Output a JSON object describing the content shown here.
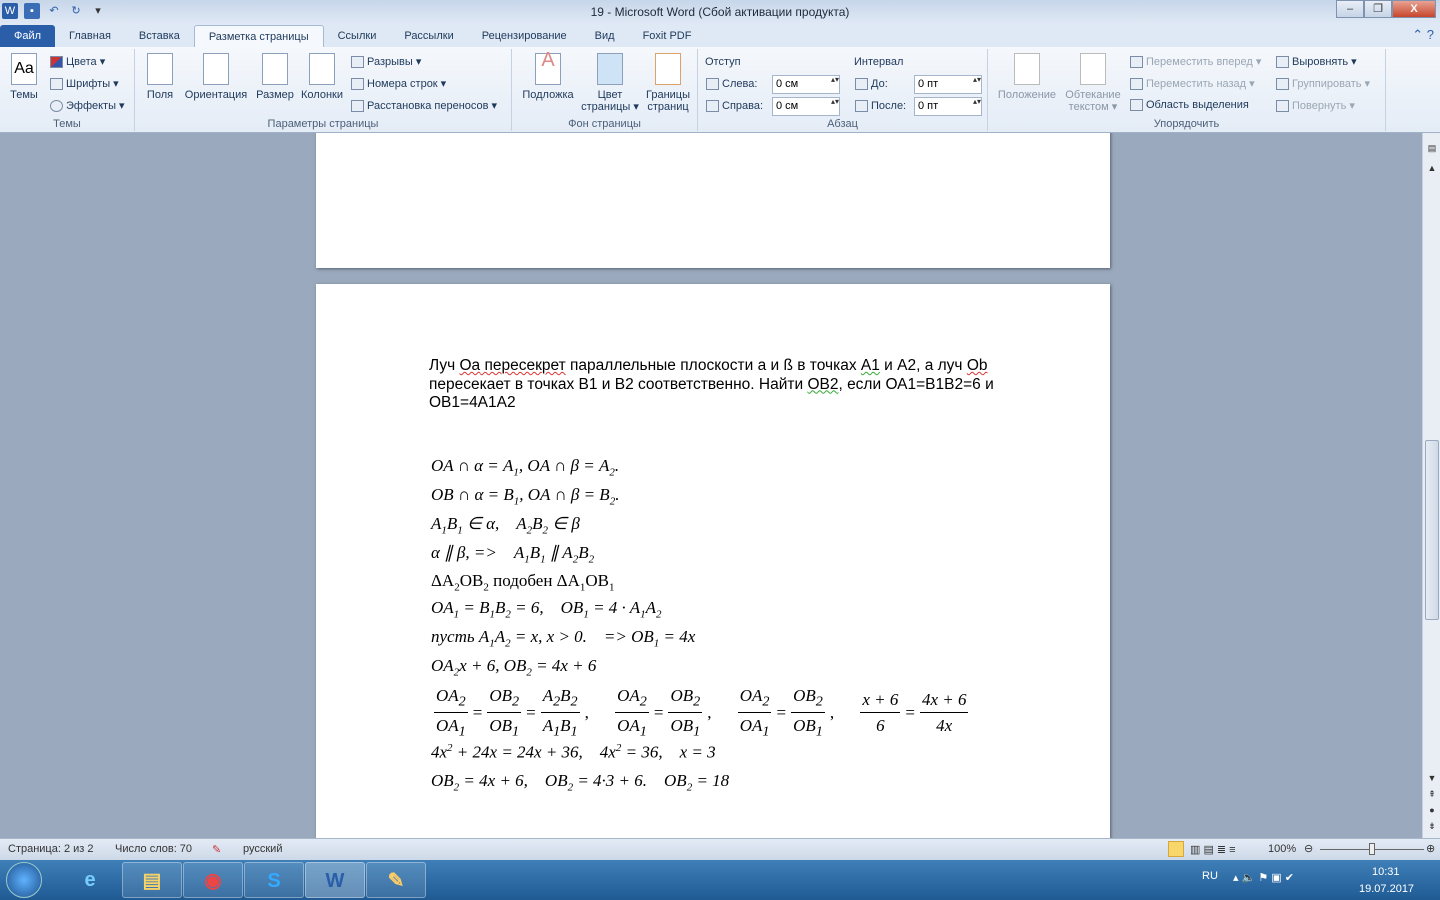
{
  "window": {
    "title": "19  -  Microsoft Word (Сбой активации продукта)",
    "minimize": "–",
    "restore": "❐",
    "close": "X"
  },
  "tabs": [
    "Файл",
    "Главная",
    "Вставка",
    "Разметка страницы",
    "Ссылки",
    "Рассылки",
    "Рецензирование",
    "Вид",
    "Foxit PDF"
  ],
  "active_tab": "Разметка страницы",
  "ribbon": {
    "themes": {
      "label": "Темы",
      "themes_btn": "Темы",
      "colors": "Цвета ▾",
      "fonts": "Шрифты ▾",
      "effects": "Эффекты ▾"
    },
    "page_setup": {
      "label": "Параметры страницы",
      "margins": "Поля",
      "orientation": "Ориентация",
      "size": "Размер",
      "columns": "Колонки",
      "breaks": "Разрывы ▾",
      "line_numbers": "Номера строк ▾",
      "hyphenation": "Расстановка переносов ▾"
    },
    "page_background": {
      "label": "Фон страницы",
      "watermark": "Подложка",
      "page_color": "Цвет страницы ▾",
      "page_borders": "Границы страниц"
    },
    "paragraph": {
      "label": "Абзац",
      "indent": "Отступ",
      "left_label": "Слева:",
      "left_value": "0 см",
      "right_label": "Справа:",
      "right_value": "0 см",
      "spacing": "Интервал",
      "before_label": "До:",
      "before_value": "0 пт",
      "after_label": "После:",
      "after_value": "0 пт"
    },
    "arrange": {
      "label": "Упорядочить",
      "position": "Положение",
      "wrap": "Обтекание текстом ▾",
      "bring_forward": "Переместить вперед ▾",
      "send_backward": "Переместить назад ▾",
      "selection_pane": "Область выделения",
      "align": "Выровнять ▾",
      "group": "Группировать ▾",
      "rotate": "Повернуть ▾"
    }
  },
  "document": {
    "task_parts": [
      "Луч ",
      "Оа",
      " пересекрет",
      " параллельные плоскости а и ß в точках ",
      "А1",
      " и А2, а луч ",
      "Ob",
      " пересекает в точках В1 и В2 соответственно. Найти ",
      "ОВ2",
      ", если ОА1=В1В2=6 и ОВ1=4А1А2"
    ],
    "math_lines": [
      "OA ∩ α = A_1, OA ∩ β = A_2.",
      "OB ∩ α = B_1, OA ∩ β = B_2.",
      "A_1B_1 ∈ α,    A_2B_2 ∈ β",
      "α ∥ β, =>    A_1B_1 ∥ A_2B_2",
      "ΔA_2OB_2 подобен ΔA_1OB_1",
      "OA_1 = B_1B_2 = 6,    OB_1 = 4 · A_1A_2",
      "пусть A_1A_2 = x, x > 0.    => OB_1 = 4x",
      "OA_2x + 6, OB_2 = 4x + 6",
      "FRACTIONS",
      "4x^2 + 24x = 24x + 36,    4x^2 = 36,    x = 3",
      "OB_2 = 4x + 6,    OB_2 = 4·3 + 6.    OB_2 = 18"
    ],
    "fractions": [
      {
        "n": "OA_2",
        "d": "OA_1"
      },
      "=",
      {
        "n": "OB_2",
        "d": "OB_1"
      },
      "=",
      {
        "n": "A_2B_2",
        "d": "A_1B_1"
      },
      ",     ",
      {
        "n": "OA_2",
        "d": "OA_1"
      },
      "=",
      {
        "n": "OB_2",
        "d": "OB_1"
      },
      ",     ",
      {
        "n": "OA_2",
        "d": "OA_1"
      },
      "=",
      {
        "n": "OB_2",
        "d": "OB_1"
      },
      ",     ",
      {
        "n": "x + 6",
        "d": "6"
      },
      "=",
      {
        "n": "4x + 6",
        "d": "4x"
      }
    ]
  },
  "status": {
    "page": "Страница: 2 из 2",
    "words": "Число слов: 70",
    "language": "русский",
    "zoom": "100%",
    "zoom_percent": 100
  },
  "taskbar": {
    "lang": "RU",
    "time": "10:31",
    "date": "19.07.2017",
    "apps": [
      "internet-explorer",
      "explorer",
      "chrome",
      "skype",
      "word",
      "paint"
    ]
  }
}
